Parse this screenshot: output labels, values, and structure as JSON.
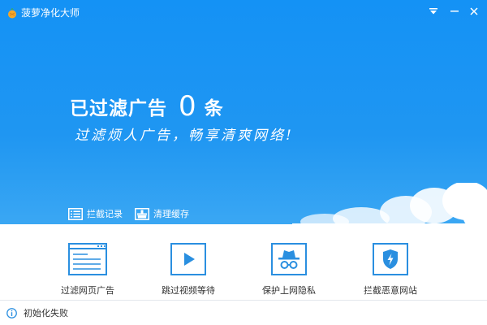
{
  "window": {
    "title": "菠萝净化大师",
    "icons": [
      "app-logo",
      "menu-icon",
      "minimize-icon",
      "close-icon"
    ]
  },
  "hero": {
    "headline_prefix": "已过滤广告",
    "filtered_count": "0",
    "headline_unit": "条",
    "slogan": "过滤烦人广告，畅享清爽网络!",
    "links": [
      {
        "label": "拦截记录",
        "icon": "list-icon"
      },
      {
        "label": "清理缓存",
        "icon": "clean-icon"
      }
    ]
  },
  "features": [
    {
      "label": "过滤网页广告",
      "icon": "webpage-icon"
    },
    {
      "label": "跳过视频等待",
      "icon": "play-icon"
    },
    {
      "label": "保护上网隐私",
      "icon": "incognito-icon"
    },
    {
      "label": "拦截恶意网站",
      "icon": "shield-icon"
    }
  ],
  "status": {
    "text": "初始化失败",
    "icon": "info-icon"
  },
  "colors": {
    "brand_blue": "#1b93f3",
    "icon_blue": "#2a8fe0",
    "text": "#333333"
  }
}
